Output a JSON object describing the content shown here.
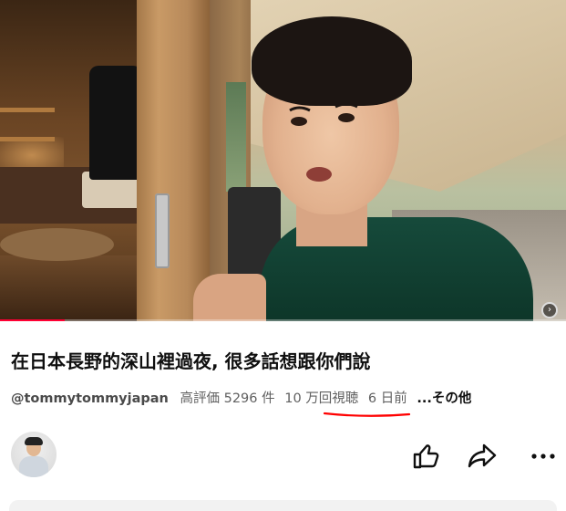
{
  "video": {
    "progress_percent": 11.5,
    "progress_color": "#ff0033",
    "corner_icon": "chevron-right-icon"
  },
  "title": "在日本長野的深山裡過夜, 很多話想跟你們說",
  "meta": {
    "channel": "@tommytommyjapan",
    "likes": "高評価 5296 件",
    "views": "10 万回視聴",
    "age": "6 日前",
    "more": "...その他"
  },
  "annotation": {
    "underline_color": "#ff0000"
  },
  "actions": [
    "thumbs-up-icon",
    "share-icon",
    "more-horizontal-icon"
  ]
}
